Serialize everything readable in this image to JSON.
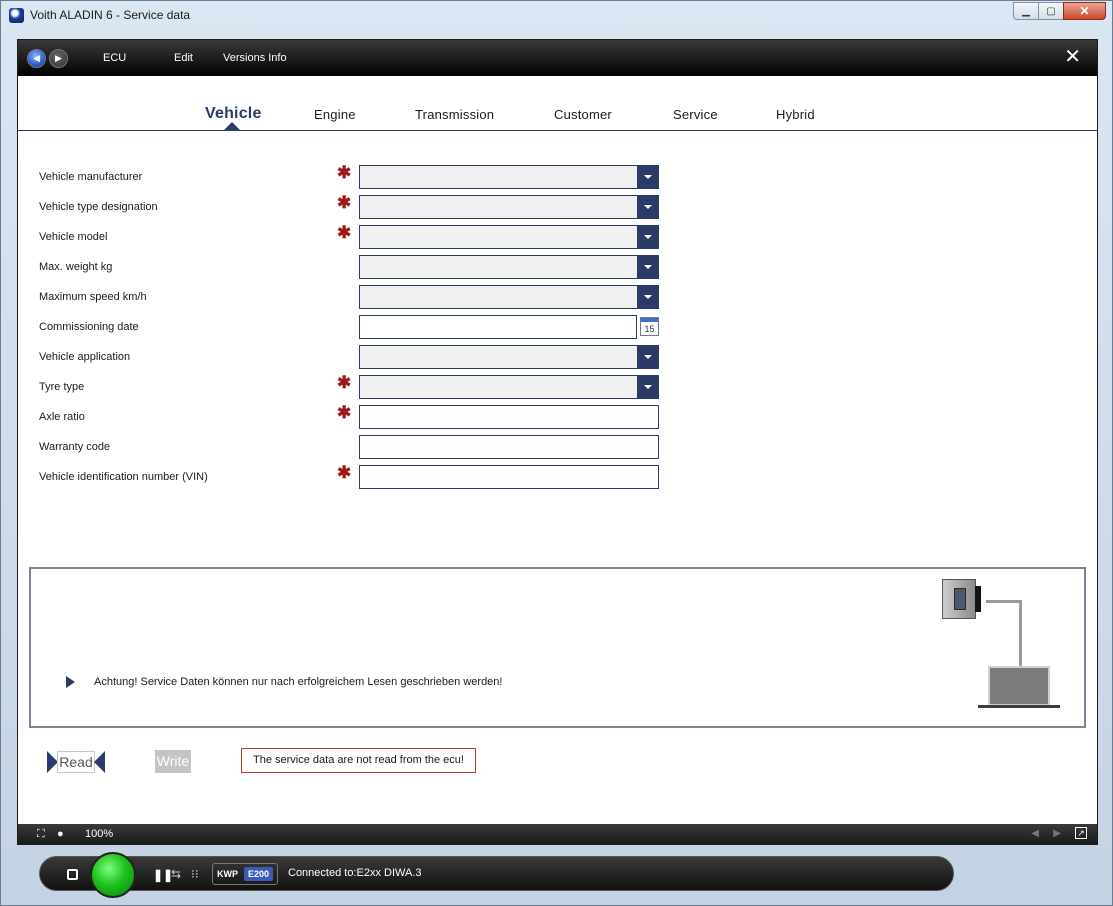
{
  "window": {
    "title": "Voith ALADIN 6 - Service data",
    "minimize": "▁",
    "maximize": "▢",
    "close": "✕"
  },
  "menu": {
    "items": [
      "ECU",
      "Edit",
      "Versions Info"
    ],
    "close_label": "✕"
  },
  "tabs": [
    {
      "label": "Vehicle",
      "active": true
    },
    {
      "label": "Engine"
    },
    {
      "label": "Transmission"
    },
    {
      "label": "Customer"
    },
    {
      "label": "Service"
    },
    {
      "label": "Hybrid"
    }
  ],
  "form": {
    "required_mark": "✱",
    "fields": [
      {
        "label": "Vehicle manufacturer",
        "type": "select",
        "value": "",
        "required": true
      },
      {
        "label": "Vehicle type designation",
        "type": "select",
        "value": "",
        "required": true
      },
      {
        "label": "Vehicle model",
        "type": "select",
        "value": "",
        "required": true
      },
      {
        "label": "Max. weight kg",
        "type": "select",
        "value": "",
        "required": false
      },
      {
        "label": "Maximum speed km/h",
        "type": "select",
        "value": "",
        "required": false
      },
      {
        "label": "Commissioning date",
        "type": "date",
        "value": "",
        "required": false
      },
      {
        "label": "Vehicle application",
        "type": "select",
        "value": "",
        "required": false
      },
      {
        "label": "Tyre type",
        "type": "select",
        "value": "",
        "required": true
      },
      {
        "label": "Axle ratio",
        "type": "text",
        "value": "",
        "required": true
      },
      {
        "label": "Warranty code",
        "type": "text",
        "value": "",
        "required": false
      },
      {
        "label": "Vehicle identification number (VIN)",
        "type": "text",
        "value": "",
        "required": true
      }
    ],
    "calendar_day": "15"
  },
  "info": {
    "message": "Achtung! Service Daten können nur nach erfolgreichem Lesen geschrieben werden!"
  },
  "actions": {
    "read_label": "Read",
    "write_label": "Write",
    "status_message": "The service data are not read from the ecu!"
  },
  "statusbar": {
    "zoom": "100%"
  },
  "connection": {
    "protocol": "KWP",
    "ecu_type": "E200",
    "status": "Connected to:E2xx  DIWA.3",
    "led_color": "#1ec21e"
  },
  "colors": {
    "accent": "#2b3a67",
    "required": "#9b1b1b",
    "error_border": "#c0392b"
  }
}
